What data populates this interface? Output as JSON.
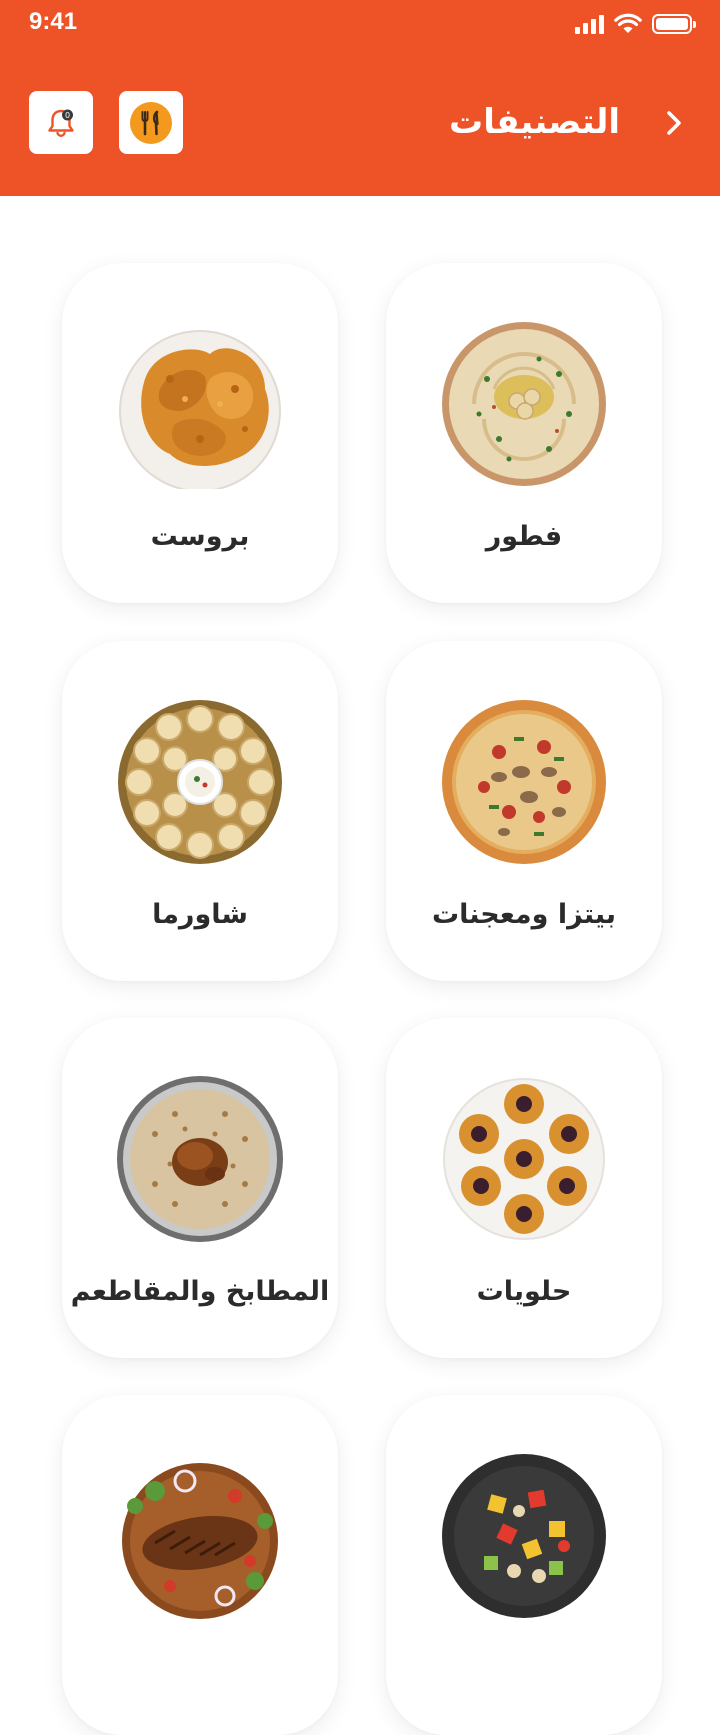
{
  "status_bar": {
    "time": "9:41"
  },
  "header": {
    "title": "التصنيفات",
    "notification_count": "0",
    "accent_color": "#ED5327"
  },
  "categories": [
    {
      "label": "فطور",
      "icon": "hummus-plate"
    },
    {
      "label": "بروست",
      "icon": "fried-chicken-plate"
    },
    {
      "label": "بيتزا ومعجنات",
      "icon": "pizza"
    },
    {
      "label": "شاورما",
      "icon": "shawarma-rolls-platter"
    },
    {
      "label": "حلويات",
      "icon": "sweets-plate"
    },
    {
      "label": "المطابخ والمقاطعم",
      "icon": "mandi-rice-chicken"
    },
    {
      "label": "",
      "icon": "fruit-salad-bowl"
    },
    {
      "label": "",
      "icon": "grilled-fish-plate"
    }
  ]
}
